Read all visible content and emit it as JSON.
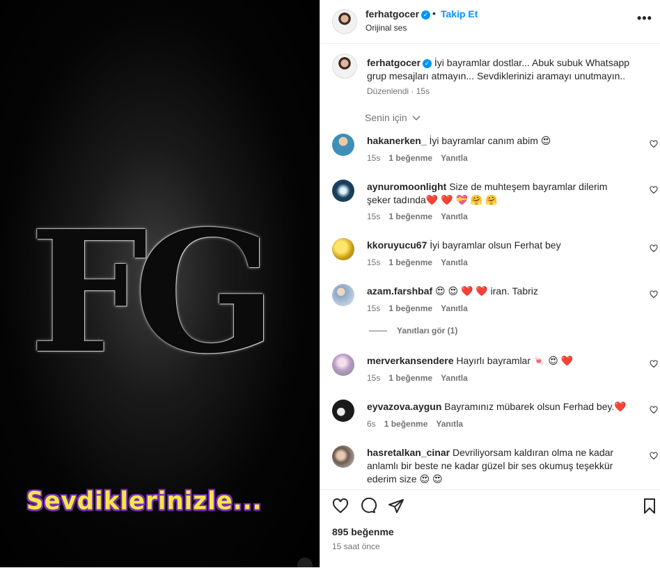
{
  "media": {
    "logo_letters": [
      "F",
      "G"
    ],
    "caption": "Sevdiklerinizle..."
  },
  "header": {
    "username": "ferhatgocer",
    "separator": "•",
    "follow_label": "Takip Et",
    "audio": "Orijinal ses",
    "more_label": "•••"
  },
  "caption": {
    "username": "ferhatgocer",
    "text": "İyi bayramlar dostlar... Abuk subuk Whatsapp grup mesajları atmayın... Sevdiklerinizi aramayı unutmayın..",
    "edited": "Düzenlendi",
    "time": "15s"
  },
  "sort_label": "Senin için",
  "comments": [
    {
      "user": "hakanerken_",
      "text": "İyi bayramlar canım abim 😍",
      "time": "15s",
      "likes": "1 beğenme",
      "reply": "Yanıtla",
      "avatar_color": "#3d8fb8"
    },
    {
      "user": "aynuromoonlight",
      "text": "Size de muhteşem bayramlar dilerim şeker tadında❤️ ❤️ 💝 🤗 🤗",
      "time": "15s",
      "likes": "1 beğenme",
      "reply": "Yanıtla",
      "avatar_color": "#1a3f5c"
    },
    {
      "user": "kkoruyucu67",
      "text": "İyi bayramlar olsun Ferhat bey",
      "time": "15s",
      "likes": "1 beğenme",
      "reply": "Yanıtla",
      "avatar_color": "#e0b21c"
    },
    {
      "user": "azam.farshbaf",
      "text": "😍 😍 ❤️ ❤️ iran. Tabriz",
      "time": "15s",
      "likes": "1 beğenme",
      "reply": "Yanıtla",
      "avatar_color": "#8aa7c7"
    },
    {
      "user": "merverkansendere",
      "text": "Hayırlı bayramlar 🍬 😍 ❤️",
      "time": "15s",
      "likes": "1 beğenme",
      "reply": "Yanıtla",
      "avatar_color": "#b99bc9"
    },
    {
      "user": "eyvazova.aygun",
      "text": "Bayramınız mübarek olsun Ferhad bey.❤️",
      "time": "6s",
      "likes": "1 beğenme",
      "reply": "Yanıtla",
      "avatar_color": "#1a1a1a"
    },
    {
      "user": "hasretalkan_cinar",
      "text": "Devriliyorsam kaldıran olma ne kadar anlamlı bir beste ne kadar güzel bir ses okumuş teşekkür ederim size 😍 😍",
      "time": "",
      "likes": "",
      "reply": "",
      "avatar_color": "#6b5a4e"
    }
  ],
  "view_replies": "Yanıtları gör (1)",
  "footer": {
    "likes": "895 beğenme",
    "time": "15 saat önce"
  },
  "colors": {
    "accent": "#0095f6",
    "text": "#262626",
    "muted": "#737373",
    "caption_yellow": "#f5e64a",
    "caption_purple": "#7a2fb5"
  }
}
